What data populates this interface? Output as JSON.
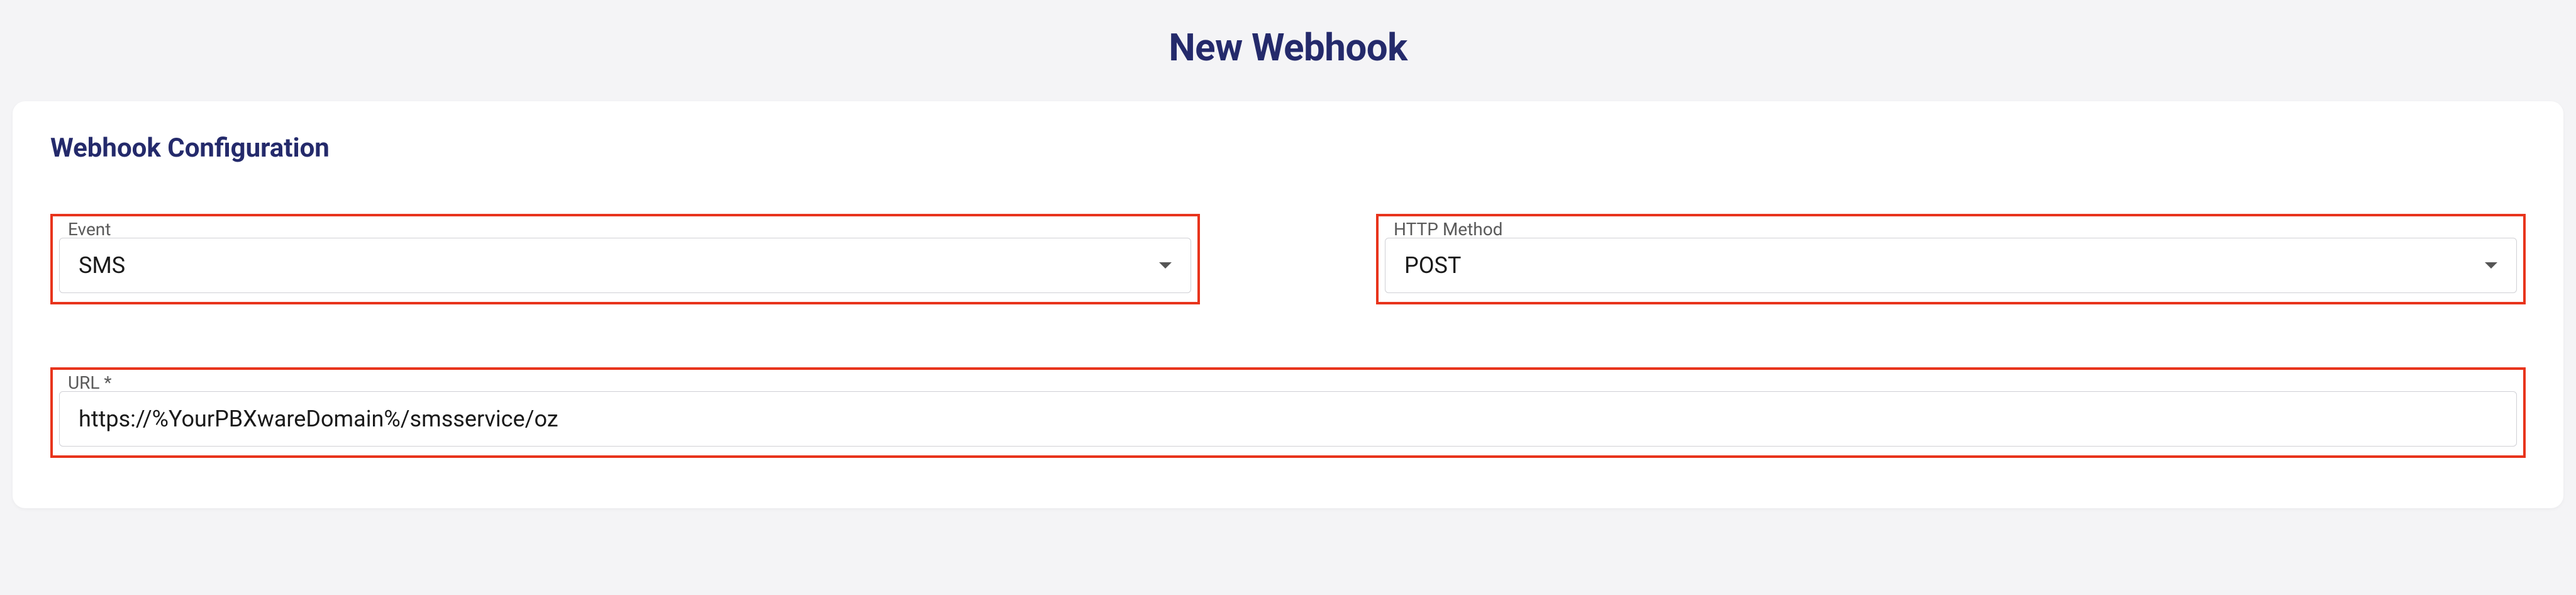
{
  "page_title": "New Webhook",
  "section_title": "Webhook Configuration",
  "fields": {
    "event": {
      "label": "Event",
      "value": "SMS"
    },
    "http_method": {
      "label": "HTTP Method",
      "value": "POST"
    },
    "url": {
      "label": "URL *",
      "value": "https://%YourPBXwareDomain%/smsservice/oz"
    }
  }
}
